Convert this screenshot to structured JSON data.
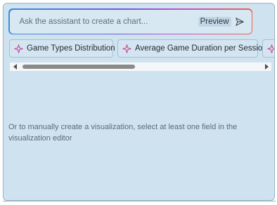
{
  "prompt": {
    "placeholder": "Ask the assistant to create a chart...",
    "preview_label": "Preview"
  },
  "suggestions": [
    {
      "label": "Game Types Distribution",
      "icon": "sparkle-icon"
    },
    {
      "label": "Average Game Duration per Session",
      "icon": "sparkle-icon"
    },
    {
      "label": "",
      "icon": "sparkle-icon"
    }
  ],
  "hint_text": "Or to manually create a visualization, select at least one field in the visualization editor",
  "colors": {
    "panel_bg": "#cfe2ef",
    "gradient_start": "#3c8edb",
    "gradient_end": "#f0604a",
    "sparkle": "#c4469a"
  }
}
